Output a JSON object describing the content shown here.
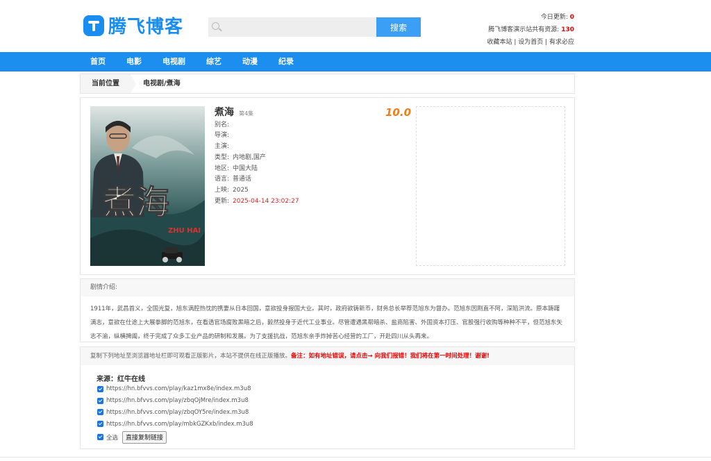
{
  "header": {
    "logo_text": "腾飞博客",
    "search_placeholder": "",
    "search_button": "搜索",
    "today_label": "今日更新:",
    "today_count": "0",
    "total_label": "腾飞博客演示站共有资源:",
    "total_count": "130",
    "links_text": "收藏本站 | 设为首页 | 有求必应"
  },
  "nav": {
    "items": [
      "首页",
      "电影",
      "电视剧",
      "综艺",
      "动漫",
      "纪录"
    ]
  },
  "breadcrumb": {
    "label": "当前位置",
    "path": "电视剧/煮海"
  },
  "movie": {
    "title": "煮海",
    "episode": "第4集",
    "score": "10.0",
    "poster_title": "煮海",
    "poster_sub": "ZHU HAI",
    "fields": [
      {
        "key": "别名:",
        "value": ""
      },
      {
        "key": "导演:",
        "value": ""
      },
      {
        "key": "主演:",
        "value": ""
      },
      {
        "key": "类型:",
        "value": "内地剧,国产"
      },
      {
        "key": "地区:",
        "value": "中国大陆"
      },
      {
        "key": "语言:",
        "value": "普通话"
      },
      {
        "key": "上映:",
        "value": "2025"
      },
      {
        "key": "更新:",
        "value": "2025-04-14 23:02:27"
      }
    ]
  },
  "plot": {
    "heading": "剧情介绍:",
    "text": "1911年，武昌首义，全国光复，旭东满腔热忱的携妻从日本回国，意欲投身报国大业。其时，政府欲铸新币，财务总长举荐范旭东为督办。范旭东因刚直不阿，深陷洪流。原本踌躇满志，意欲在仕途上大展拳脚的范旭东，在看透官场腐败黑暗之后，毅然投身于近代工业事业。尽管遭遇黑帮暗杀、盐商陷害、外国资本打压、官股强行收购等种种不平，但范旭东矢志不渝，纵横捭阖，终于完成了众多工业产品的研制和发展。为了支援抗战，范旭东亲手炸掉苦心经营的工厂，开赴四川从头再来。"
  },
  "play": {
    "notice": "复制下列地址至浏览器地址栏即可观看正版影片，本站不提供在线正版播放。",
    "notice_red": "备注：如有地址错误，请点击→ 向我们报错！我们将在第一时间处理！谢谢!",
    "source": "来源：红牛在线",
    "links": [
      "https://hn.bfvvs.com/play/kaz1mx8e/index.m3u8",
      "https://hn.bfvvs.com/play/zbqOjMre/index.m3u8",
      "https://hn.bfvvs.com/play/zbqOY5re/index.m3u8",
      "https://hn.bfvvs.com/play/mbkGZKxb/index.m3u8"
    ],
    "select_all": "全选",
    "copy_button": "直接复制链接"
  }
}
